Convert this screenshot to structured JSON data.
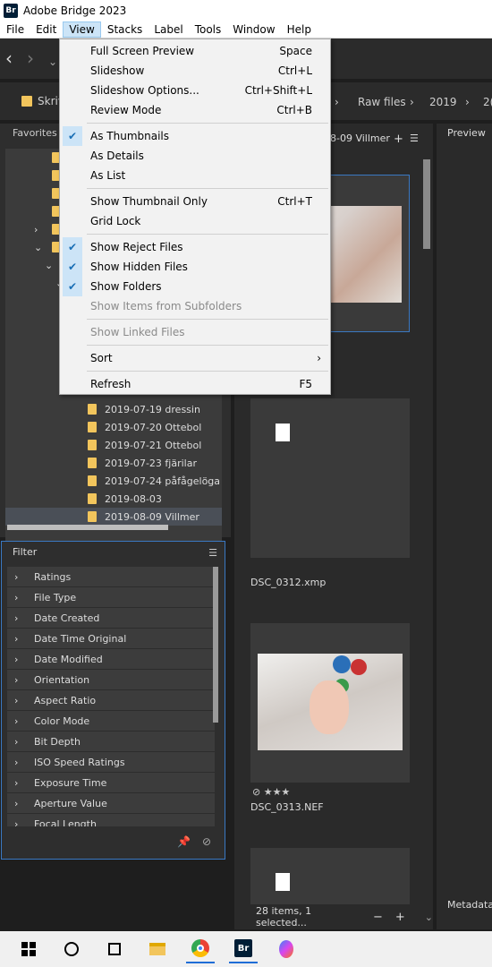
{
  "app": {
    "title": "Adobe Bridge 2023",
    "logo": "Br"
  },
  "menubar": {
    "items": [
      "File",
      "Edit",
      "View",
      "Stacks",
      "Label",
      "Tools",
      "Window",
      "Help"
    ],
    "active": "View"
  },
  "toolbar": {
    "back_icon": "chevron-left-icon",
    "forward_icon": "chevron-right-icon"
  },
  "pathbar": {
    "first": "Skriv",
    "raw": "Raw files",
    "year": "2019",
    "last": "2("
  },
  "left_panel": {
    "tab": "Favorites"
  },
  "tree": {
    "items": [
      "2019-07-19 dressin",
      "2019-07-20 Ottebol",
      "2019-07-21 Ottebol",
      "2019-07-23 fjärilar",
      "2019-07-24 påfågelöga",
      "2019-08-03",
      "2019-08-09 Villmer"
    ],
    "selected": "2019-08-09 Villmer"
  },
  "filter": {
    "title": "Filter",
    "items": [
      "Ratings",
      "File Type",
      "Date Created",
      "Date Time Original",
      "Date Modified",
      "Orientation",
      "Aspect Ratio",
      "Color Mode",
      "Bit Depth",
      "ISO Speed Ratings",
      "Exposure Time",
      "Aperture Value",
      "Focal Length"
    ]
  },
  "content": {
    "tab": "08-09 Villmer",
    "thumbs": [
      {
        "name": "DSC_0312.xmp"
      },
      {
        "name": "DSC_0313.NEF",
        "rating": 3
      }
    ],
    "status": "28 items, 1 selected..."
  },
  "right_panel": {
    "preview": "Preview",
    "metadata": "Metadata"
  },
  "view_menu": {
    "items": [
      {
        "label": "Full Screen Preview",
        "shortcut": "Space"
      },
      {
        "label": "Slideshow",
        "shortcut": "Ctrl+L"
      },
      {
        "label": "Slideshow Options...",
        "shortcut": "Ctrl+Shift+L"
      },
      {
        "label": "Review Mode",
        "shortcut": "Ctrl+B"
      },
      {
        "label": "As Thumbnails",
        "checked": true
      },
      {
        "label": "As Details"
      },
      {
        "label": "As List"
      },
      {
        "label": "Show Thumbnail Only",
        "shortcut": "Ctrl+T"
      },
      {
        "label": "Grid Lock"
      },
      {
        "label": "Show Reject Files",
        "checked": true
      },
      {
        "label": "Show Hidden Files",
        "checked": true
      },
      {
        "label": "Show Folders",
        "checked": true
      },
      {
        "label": "Show Items from Subfolders",
        "disabled": true
      },
      {
        "label": "Show Linked Files",
        "disabled": true
      },
      {
        "label": "Sort",
        "submenu": true
      },
      {
        "label": "Refresh",
        "shortcut": "F5"
      }
    ]
  },
  "colors": {
    "accent": "#3a78c2",
    "folder": "#f2c55c",
    "menu_bg": "#f2f2f2",
    "check_bg": "#cce4f7"
  }
}
